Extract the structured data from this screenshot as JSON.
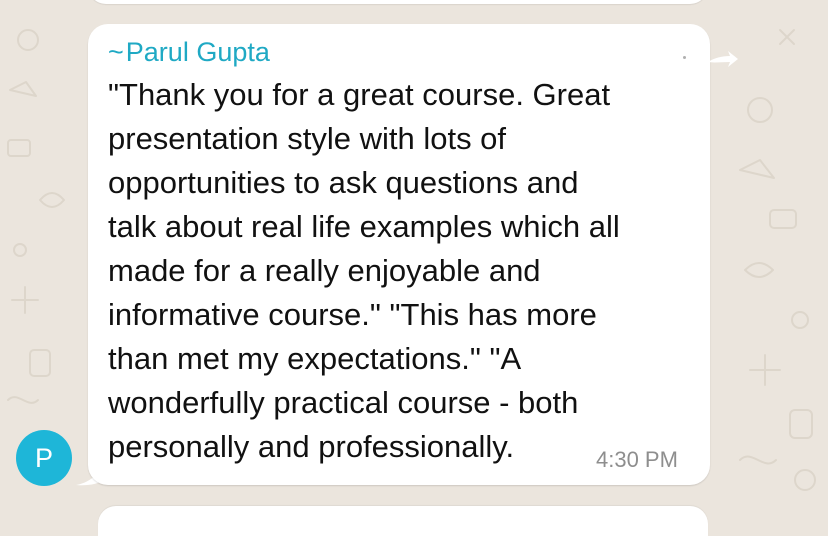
{
  "message": {
    "sender_prefix": "~",
    "sender_name": "Parul Gupta",
    "lines": [
      "\"Thank you for a great course. Great",
      "presentation style with lots of",
      "opportunities to ask questions and",
      "talk about real life examples which all",
      "made for a really enjoyable and",
      "informative course.\" \"This has more",
      "than met my expectations.\" \"A",
      "wonderfully practical course - both",
      "personally and professionally."
    ],
    "time": "4:30 PM"
  },
  "avatar": {
    "initial": "P",
    "color": "#1eb6d8"
  },
  "colors": {
    "chat_background": "#ebe5dd",
    "bubble": "#ffffff",
    "sender_name": "#1fa9c4",
    "timestamp": "#8e8e8e"
  },
  "icons": {
    "forward": "share-arrow-icon",
    "menu": "dot-icon"
  }
}
